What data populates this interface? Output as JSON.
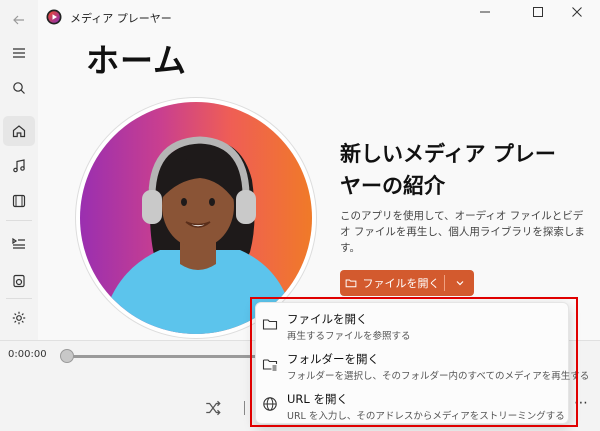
{
  "app": {
    "title": "メディア プレーヤー"
  },
  "home": {
    "page_title": "ホーム",
    "intro_title": "新しいメディア プレーヤーの紹介",
    "intro_text": "このアプリを使用して、オーディオ ファイルとビデオ ファイルを再生し、個人用ライブラリを探索します。",
    "open_button_label": "ファイルを開く"
  },
  "player": {
    "current_time": "0:00:00"
  },
  "open_menu": {
    "items": [
      {
        "label": "ファイルを開く",
        "description": "再生するファイルを参照する",
        "icon": "folder-icon"
      },
      {
        "label": "フォルダーを開く",
        "description": "フォルダーを選択し、そのフォルダー内のすべてのメディアを再生する",
        "icon": "folder-list-icon"
      },
      {
        "label": "URL を開く",
        "description": "URL を入力し、そのアドレスからメディアをストリーミングする",
        "icon": "globe-icon"
      }
    ]
  },
  "colors": {
    "accent": "#d35a2e",
    "highlight": "#e00000"
  }
}
